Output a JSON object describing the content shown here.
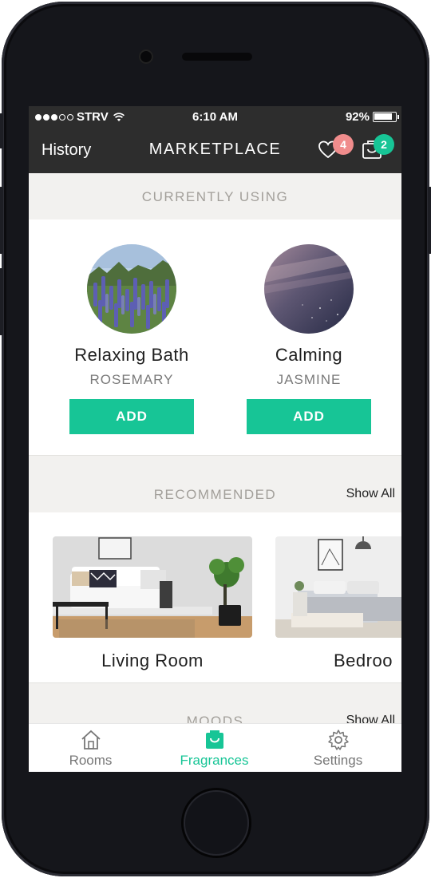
{
  "status_bar": {
    "carrier": "STRV",
    "time": "6:10 AM",
    "battery": "92%",
    "battery_level": 0.92,
    "signal_dots_filled": 3,
    "signal_dots_total": 5
  },
  "nav": {
    "left_label": "History",
    "title": "MARKETPLACE",
    "favorites_count": "4",
    "cart_count": "2"
  },
  "currently_using": {
    "title": "CURRENTLY USING",
    "items": [
      {
        "name": "Relaxing Bath",
        "scent": "ROSEMARY",
        "button": "ADD"
      },
      {
        "name": "Calming",
        "scent": "JASMINE",
        "button": "ADD"
      }
    ]
  },
  "recommended": {
    "title": "RECOMMENDED",
    "show_all": "Show All",
    "items": [
      {
        "name": "Living Room"
      },
      {
        "name": "Bedroo"
      }
    ]
  },
  "moods": {
    "title": "MOODS",
    "show_all": "Show All"
  },
  "tabs": [
    {
      "label": "Rooms",
      "icon": "house-icon"
    },
    {
      "label": "Fragrances",
      "icon": "fragrance-box-icon",
      "active": true
    },
    {
      "label": "Settings",
      "icon": "gear-icon"
    }
  ],
  "colors": {
    "accent": "#17c596",
    "header_bg": "#2d2d2d",
    "badge_red": "#f08c8c",
    "section_bg": "#f2f1ef"
  }
}
